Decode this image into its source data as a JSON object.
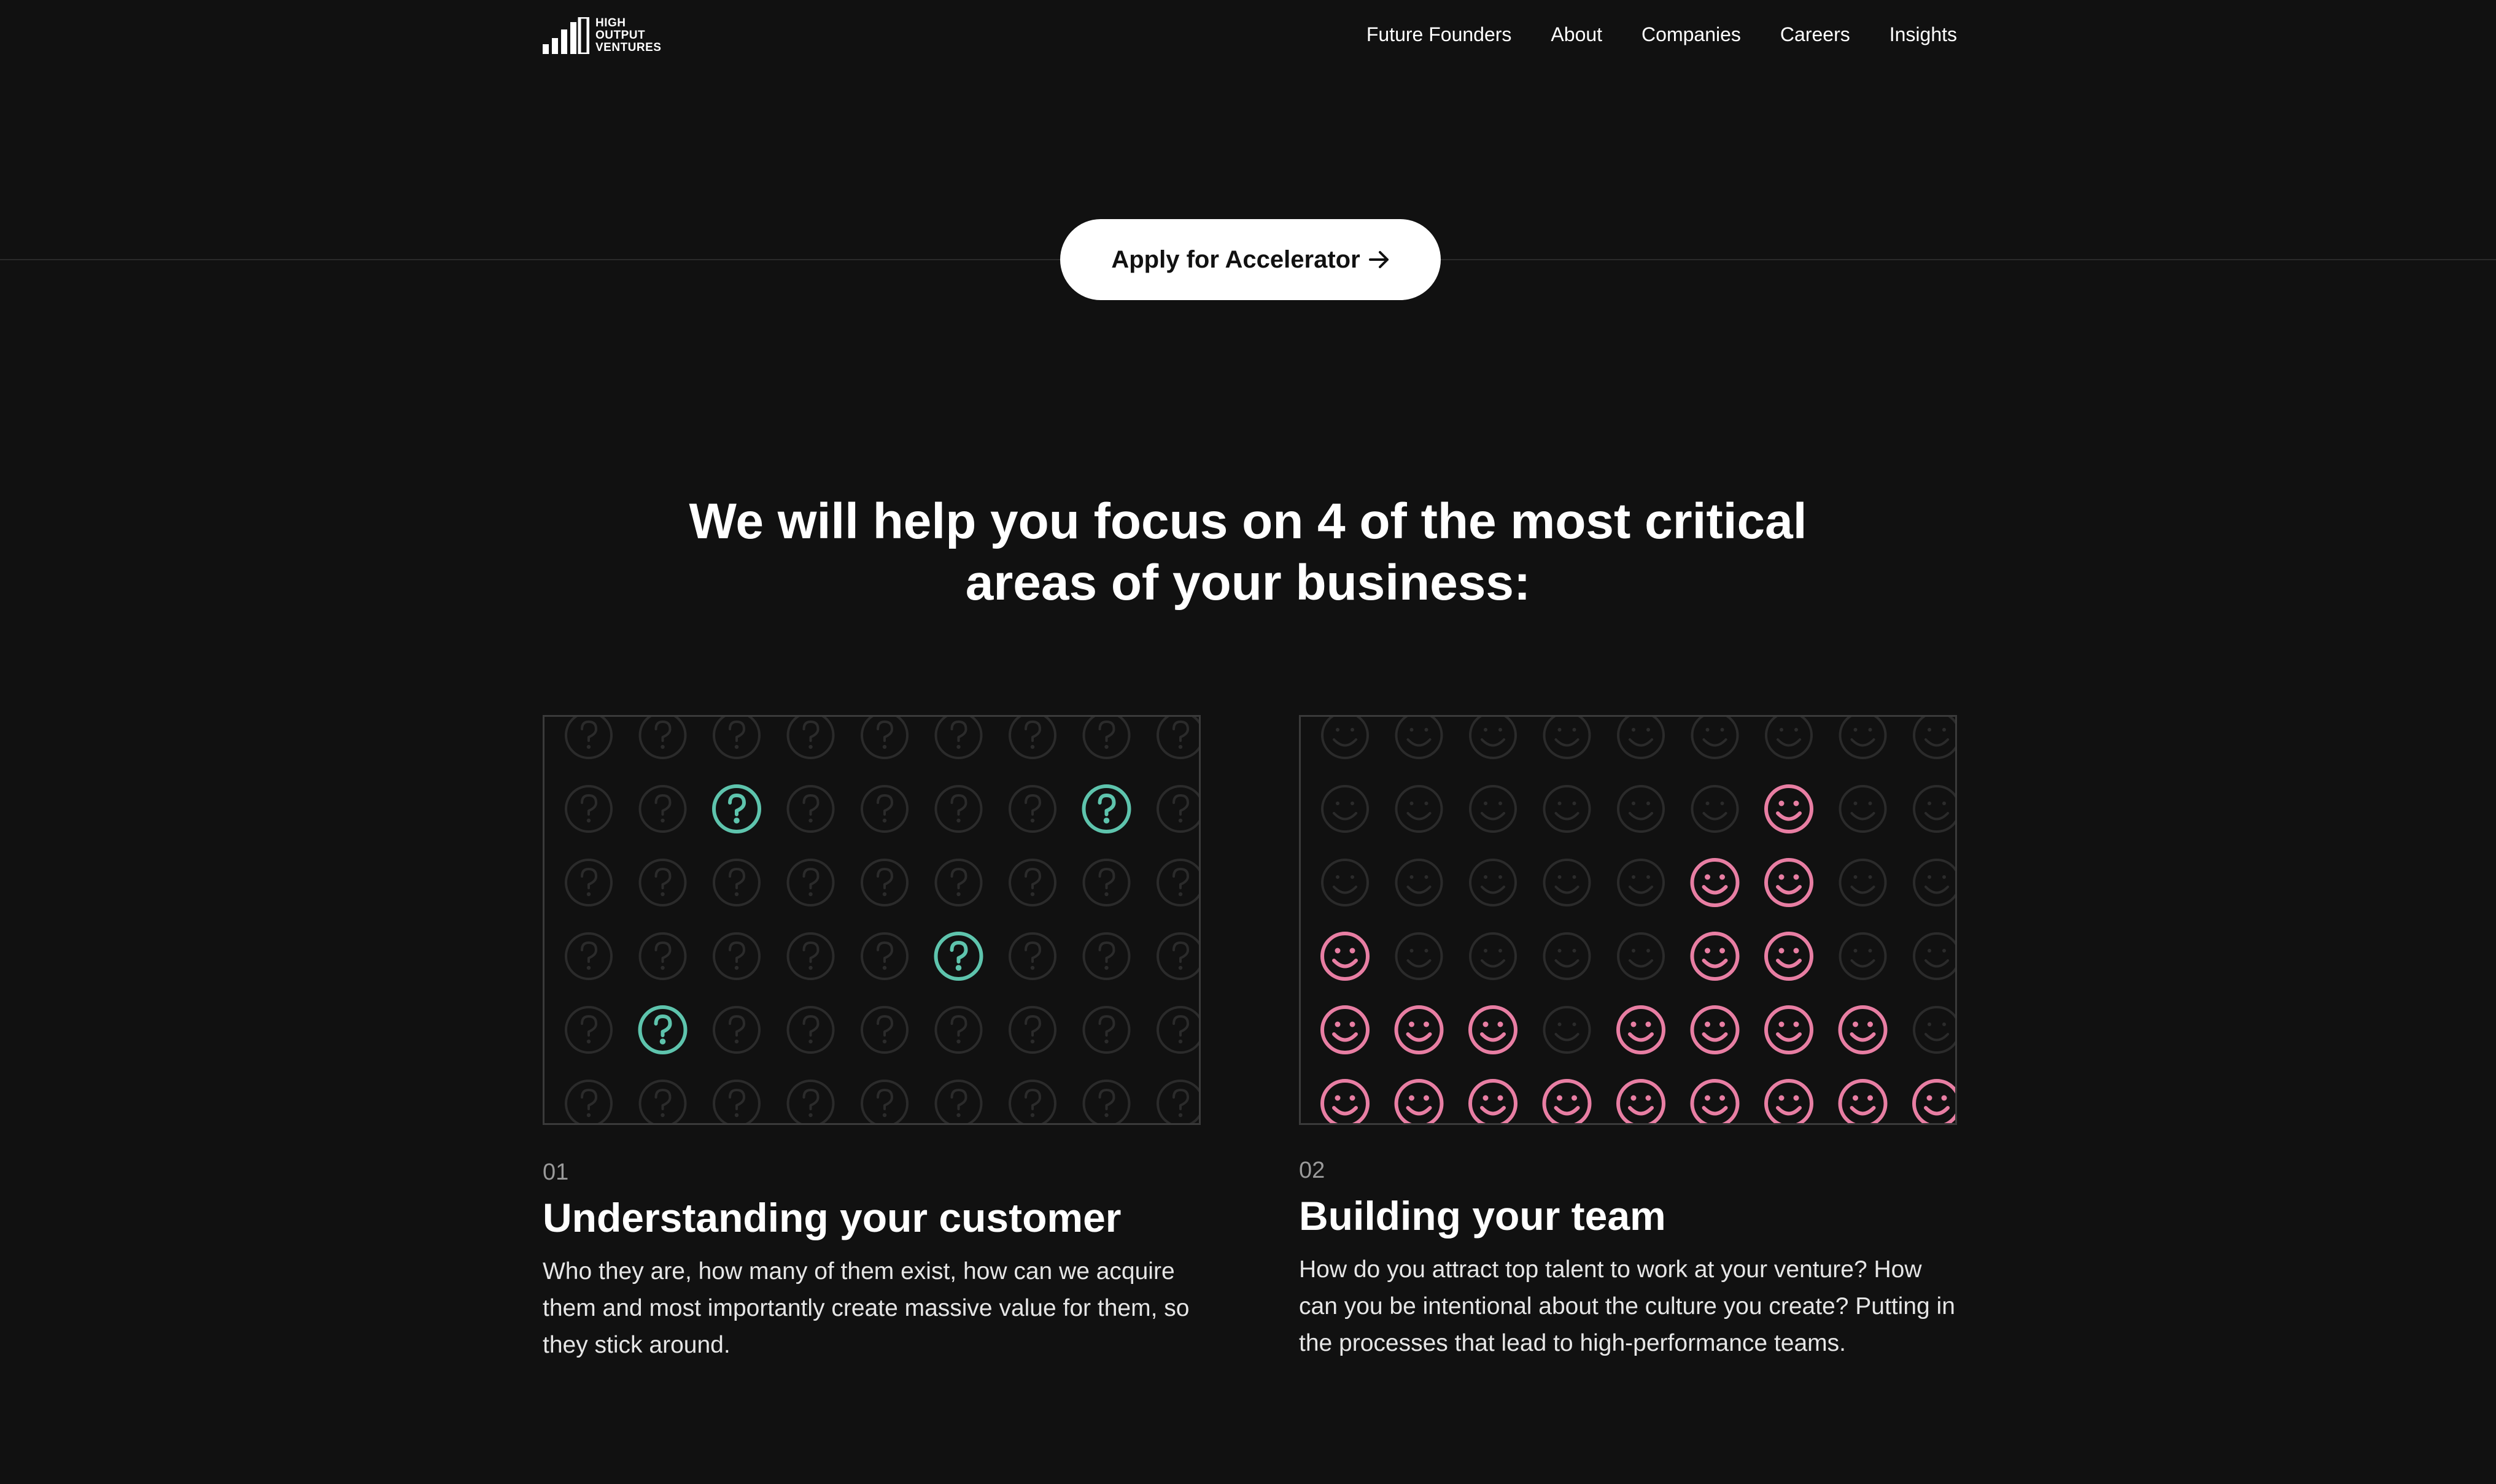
{
  "header": {
    "logo": {
      "lines": [
        "HIGH",
        "OUTPUT",
        "VENTURES"
      ]
    },
    "nav": [
      "Future Founders",
      "About",
      "Companies",
      "Careers",
      "Insights"
    ]
  },
  "hero": {
    "cta_label": "Apply for Accelerator",
    "cta_icon": "arrow-right-icon"
  },
  "section": {
    "title": "We will help you focus on 4 of the most critical areas of your business:"
  },
  "cards": [
    {
      "number": "01",
      "title": "Understanding your customer",
      "description": "Who they are, how many of them exist, how can we acquire them and most importantly create massive value for them, so they stick around.",
      "icon": "question-circle-icon",
      "accent": "#5ec4ad",
      "dim": "#2b2b2b",
      "cols": 9,
      "rows": 6,
      "highlighted": [
        [
          1,
          2
        ],
        [
          1,
          7
        ],
        [
          3,
          5
        ],
        [
          4,
          1
        ]
      ]
    },
    {
      "number": "02",
      "title": "Building your team",
      "description": "How do you attract top talent to work at your venture? How can you be intentional about the culture you create? Putting in the processes that lead to high-performance teams.",
      "icon": "smiley-face-icon",
      "accent": "#e87ea3",
      "dim": "#2b2b2b",
      "cols": 9,
      "rows": 6,
      "highlighted": [
        [
          1,
          6
        ],
        [
          2,
          5
        ],
        [
          2,
          6
        ],
        [
          3,
          0
        ],
        [
          3,
          5
        ],
        [
          3,
          6
        ],
        [
          4,
          0
        ],
        [
          4,
          1
        ],
        [
          4,
          2
        ],
        [
          4,
          4
        ],
        [
          4,
          5
        ],
        [
          4,
          6
        ],
        [
          4,
          7
        ],
        [
          5,
          0
        ],
        [
          5,
          1
        ],
        [
          5,
          2
        ],
        [
          5,
          3
        ],
        [
          5,
          4
        ],
        [
          5,
          5
        ],
        [
          5,
          6
        ],
        [
          5,
          7
        ],
        [
          5,
          8
        ]
      ]
    }
  ]
}
